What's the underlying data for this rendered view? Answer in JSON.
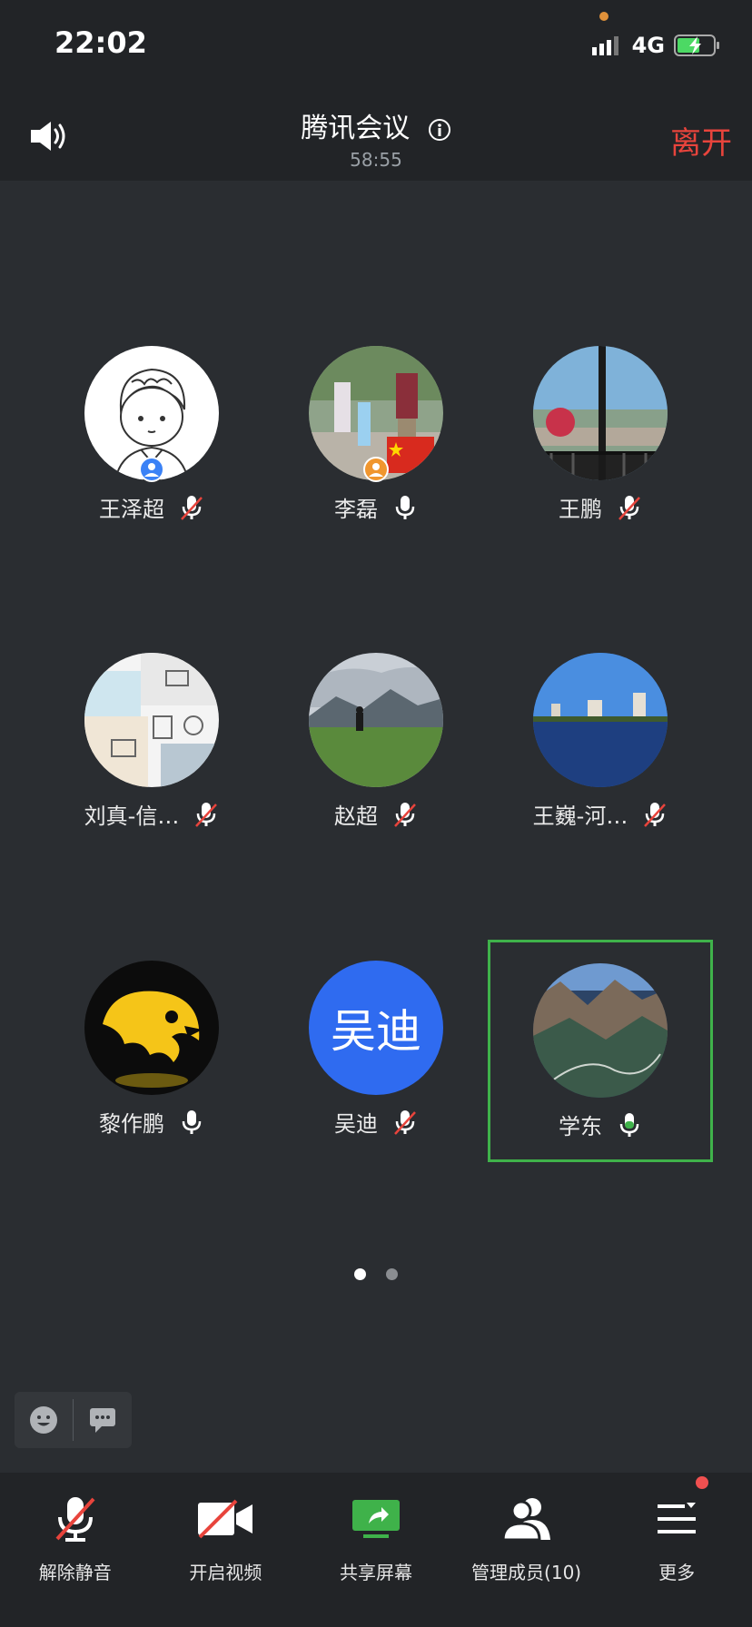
{
  "status_bar": {
    "time": "22:02",
    "network": "4G"
  },
  "header": {
    "title": "腾讯会议",
    "elapsed": "58:55",
    "leave_label": "离开"
  },
  "participants": [
    {
      "name": "王泽超",
      "mic": "muted",
      "host_badge": "blue"
    },
    {
      "name": "李磊",
      "mic": "on",
      "host_badge": "orange"
    },
    {
      "name": "王鹏",
      "mic": "muted"
    },
    {
      "name": "刘真-信…",
      "mic": "muted"
    },
    {
      "name": "赵超",
      "mic": "muted"
    },
    {
      "name": "王巍-河…",
      "mic": "muted"
    },
    {
      "name": "黎作鹏",
      "mic": "on"
    },
    {
      "name": "吴迪",
      "mic": "muted",
      "avatar_text": "吴迪"
    },
    {
      "name": "学东",
      "mic": "on",
      "speaking": true
    }
  ],
  "pagination": {
    "current": 1,
    "total": 2
  },
  "toolbar": {
    "unmute": "解除静音",
    "video": "开启视频",
    "share": "共享屏幕",
    "members": "管理成员(10)",
    "more": "更多"
  },
  "colors": {
    "accent_green": "#3fb24a",
    "leave_red": "#e8443c",
    "avatar_blue": "#2f6bf0",
    "background": "#2a2d31"
  }
}
